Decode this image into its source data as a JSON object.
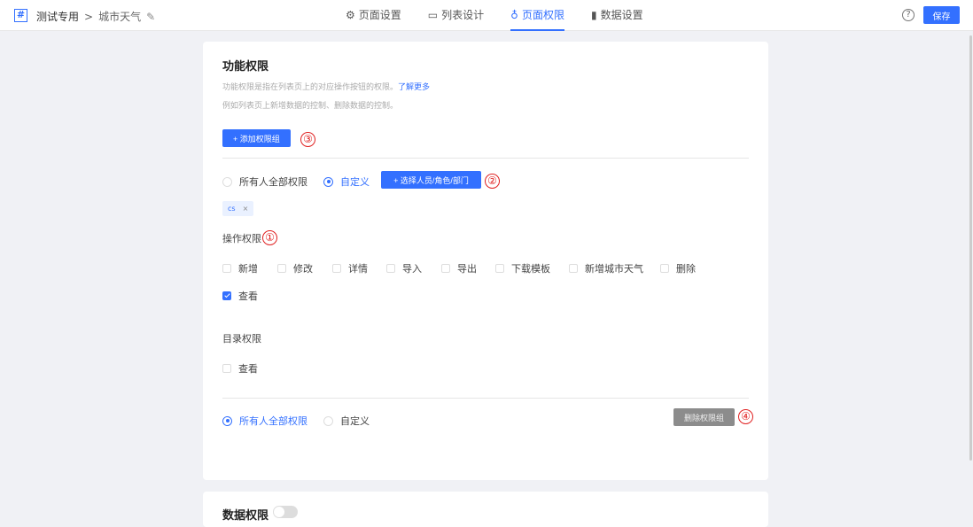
{
  "header": {
    "app": "测试专用",
    "sep": ">",
    "page": "城市天气",
    "tabs": [
      {
        "label": "页面设置",
        "icon": "gear-icon"
      },
      {
        "label": "列表设计",
        "icon": "list-icon"
      },
      {
        "label": "页面权限",
        "icon": "key-icon"
      },
      {
        "label": "数据设置",
        "icon": "chart-icon"
      }
    ],
    "active_tab": "页面权限",
    "help": "?",
    "save": "保存"
  },
  "func": {
    "title": "功能权限",
    "desc1": "功能权限是指在列表页上的对应操作按钮的权限。",
    "learn_more": "了解更多",
    "desc2": "例如列表页上新增数据的控制、删除数据的控制。",
    "add_group": "+ 添加权限组",
    "group1": {
      "radio_all": "所有人全部权限",
      "radio_custom": "自定义",
      "selected": "自定义",
      "select_btn": "+ 选择人员/角色/部门",
      "tag": "cs",
      "tag_close": "×",
      "ops_label": "操作权限",
      "ops": [
        {
          "label": "新增",
          "checked": false
        },
        {
          "label": "修改",
          "checked": false
        },
        {
          "label": "详情",
          "checked": false
        },
        {
          "label": "导入",
          "checked": false
        },
        {
          "label": "导出",
          "checked": false
        },
        {
          "label": "下载模板",
          "checked": false
        },
        {
          "label": "新增城市天气",
          "checked": false
        },
        {
          "label": "删除",
          "checked": false
        },
        {
          "label": "查看",
          "checked": true
        }
      ],
      "dir_label": "目录权限",
      "dir": [
        {
          "label": "查看",
          "checked": false
        }
      ]
    },
    "group2": {
      "radio_all": "所有人全部权限",
      "radio_custom": "自定义",
      "selected": "所有人全部权限",
      "delete_btn": "删除权限组"
    }
  },
  "annotations": [
    "①",
    "②",
    "③",
    "④"
  ],
  "data_perm": {
    "title": "数据权限",
    "toggle_on": false
  },
  "colors": {
    "accent": "#3370ff",
    "annotation": "#e02020"
  }
}
